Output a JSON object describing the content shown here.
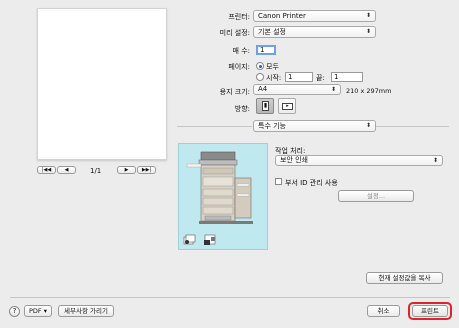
{
  "printer": {
    "label": "프린터:",
    "value": "Canon Printer"
  },
  "presets": {
    "label": "미리 설정:",
    "value": "기본 설정"
  },
  "copies": {
    "label": "매 수:",
    "value": "1"
  },
  "pages": {
    "label": "페이지:",
    "all_label": "모두",
    "from_label": "시작:",
    "from_value": "1",
    "to_label": "끝:",
    "to_value": "1",
    "selected": "all"
  },
  "paper_size": {
    "label": "용지 크기:",
    "value": "A4",
    "dimensions": "210 x 297mm"
  },
  "orientation": {
    "label": "방향:",
    "options": [
      "portrait",
      "landscape"
    ],
    "selected": "portrait"
  },
  "section_popup": {
    "value": "특수 기능"
  },
  "preview_nav": {
    "page_counter": "1/1"
  },
  "job_processing": {
    "label": "작업 처리:",
    "value": "보안 인쇄"
  },
  "dept_id": {
    "label": "부서 ID 관리 사용",
    "checked": false
  },
  "settings_button": {
    "label": "설정..."
  },
  "copy_current_button": {
    "label": "현재 설정값을 복사"
  },
  "footer": {
    "help": "?",
    "pdf": "PDF",
    "hide_details": "세부사항 가리기",
    "cancel": "취소",
    "print": "프린트"
  },
  "colors": {
    "highlight": "#e0242a",
    "preview_bg": "#bfe8ef",
    "accent": "#1d5fd1"
  },
  "icons": [
    "navigate-first-icon",
    "navigate-prev-icon",
    "navigate-next-icon",
    "navigate-last-icon",
    "printer-illustration-icon",
    "output-stack-icon",
    "chevron-updown-icon"
  ]
}
